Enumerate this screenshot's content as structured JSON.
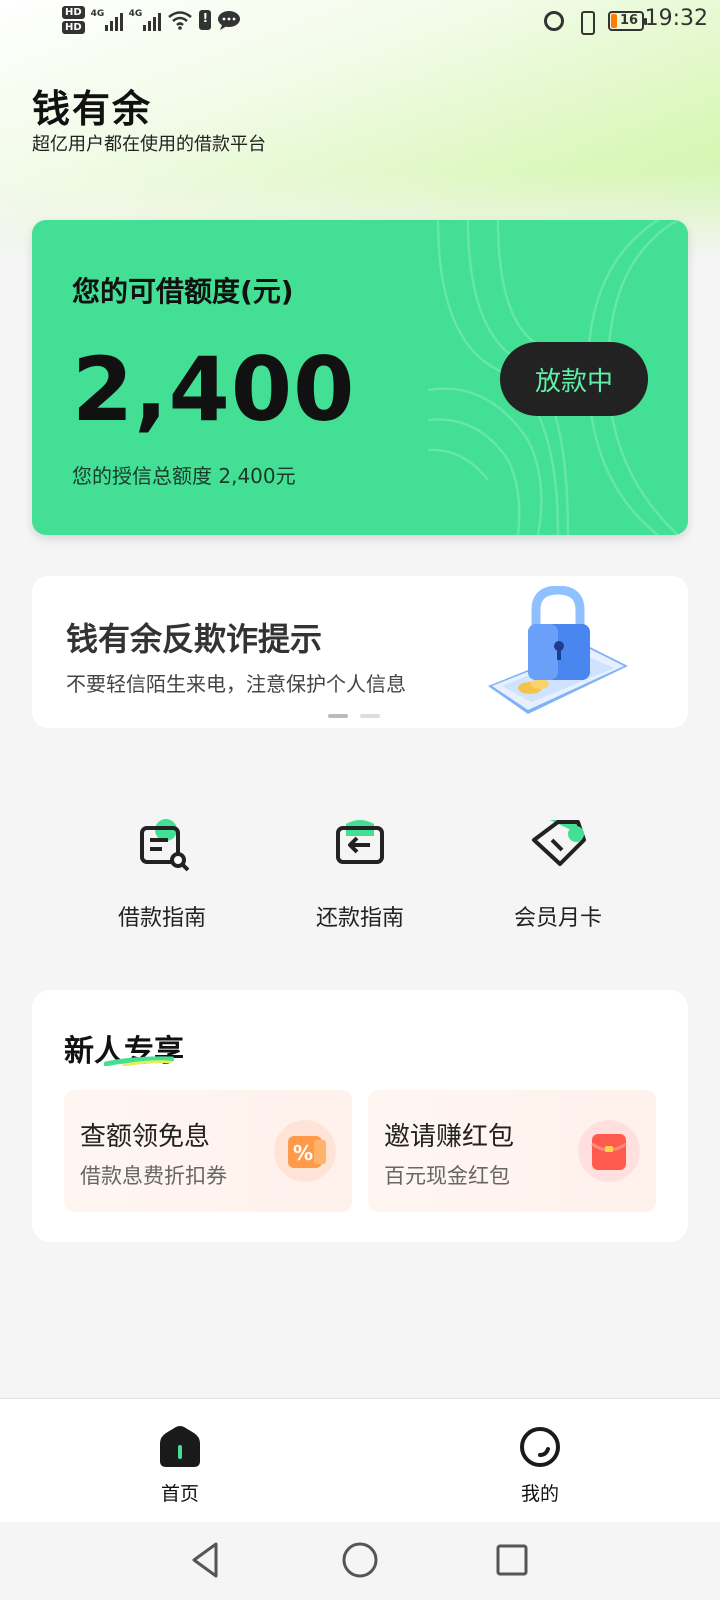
{
  "status_bar": {
    "hd1": "HD",
    "hd2": "HD",
    "net1": "4G",
    "net2": "4G",
    "battery_level": "16",
    "time": "19:32"
  },
  "header": {
    "app_name": "钱有余",
    "tagline": "超亿用户都在使用的借款平台"
  },
  "credit_card": {
    "label": "您的可借额度(元)",
    "amount": "2,400",
    "total_text": "您的授信总额度 2,400元",
    "status_button": "放款中",
    "card_color": "#42df94",
    "button_text_color": "#5ff0a8"
  },
  "banner": {
    "title": "钱有余反欺诈提示",
    "subtitle": "不要轻信陌生来电，注意保护个人信息",
    "art_icon": "padlock-phone-illustration",
    "active_slide": 1,
    "slide_count": 2
  },
  "quick_actions": [
    {
      "label": "借款指南",
      "icon": "doc-search-icon"
    },
    {
      "label": "还款指南",
      "icon": "return-arrow-icon"
    },
    {
      "label": "会员月卡",
      "icon": "tag-card-icon"
    }
  ],
  "newbie": {
    "title": "新人专享",
    "offers": [
      {
        "title": "查额领免息",
        "subtitle": "借款息费折扣券",
        "icon": "percent-coupon-icon"
      },
      {
        "title": "邀请赚红包",
        "subtitle": "百元现金红包",
        "icon": "red-envelope-icon"
      }
    ]
  },
  "bottom_nav": {
    "items": [
      {
        "label": "首页",
        "icon": "home-icon",
        "active": true
      },
      {
        "label": "我的",
        "icon": "profile-icon",
        "active": false
      }
    ]
  },
  "accent_color": "#42df94"
}
